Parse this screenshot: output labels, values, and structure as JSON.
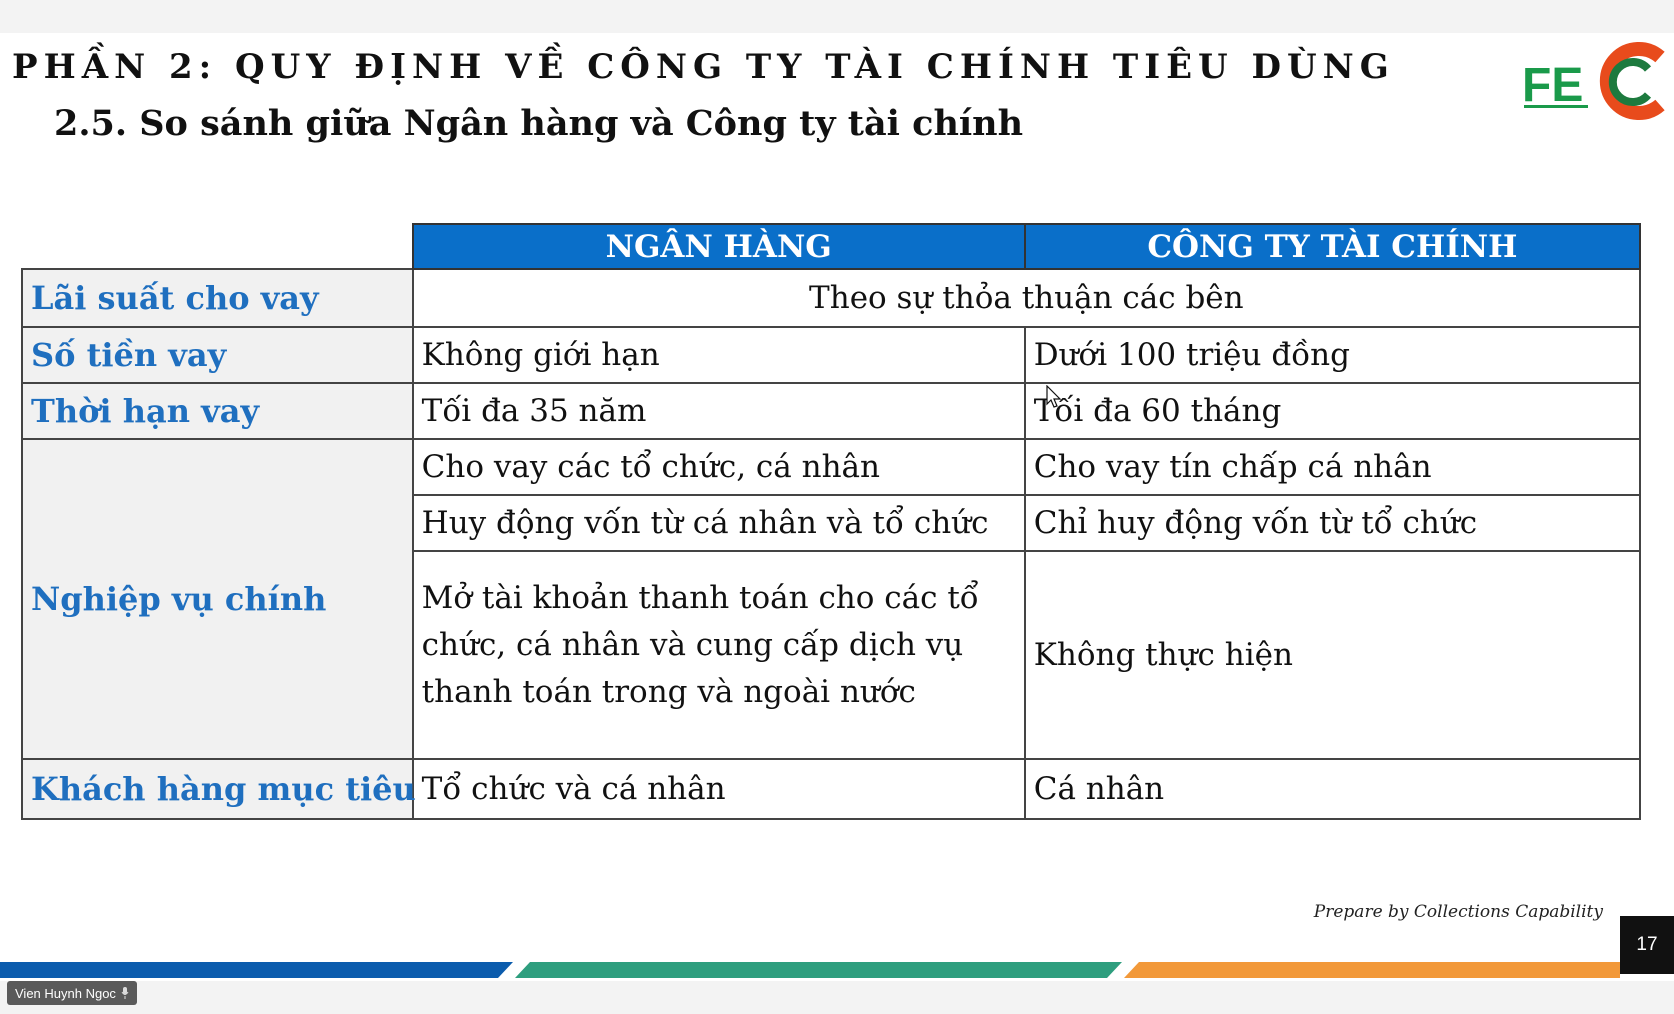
{
  "slide": {
    "heading": "PHẦN 2: QUY ĐỊNH VỀ CÔNG TY TÀI CHÍNH TIÊU DÙNG",
    "subheading": "2.5. So sánh giữa Ngân hàng và Công ty tài chính",
    "logo": {
      "text": "FE",
      "icon": "fec-logo-icon",
      "colors": [
        "#1a9a4a",
        "#e84b1c",
        "#1d7a3e"
      ]
    }
  },
  "table": {
    "columns": [
      "NGÂN HÀNG",
      "CÔNG TY TÀI CHÍNH"
    ],
    "rows": [
      {
        "label": "Lãi suất cho vay",
        "merged": "Theo sự thỏa thuận các bên"
      },
      {
        "label": "Số tiền vay",
        "bank": "Không giới hạn",
        "finance": "Dưới 100 triệu đồng"
      },
      {
        "label": "Thời hạn vay",
        "bank": "Tối đa 35 năm",
        "finance": "Tối đa 60 tháng"
      },
      {
        "label": "Nghiệp vụ chính",
        "sub": [
          {
            "bank": "Cho vay các tổ chức, cá nhân",
            "finance": "Cho vay tín chấp cá nhân"
          },
          {
            "bank": "Huy động vốn từ cá nhân và tổ chức",
            "finance": "Chỉ huy động vốn từ tổ chức"
          },
          {
            "bank_lines": [
              "Mở tài khoản thanh toán cho các tổ",
              "chức, cá nhân và cung cấp dịch vụ",
              "thanh toán trong và ngoài nước"
            ],
            "finance": "Không thực hiện"
          }
        ]
      },
      {
        "label": "Khách hàng mục tiêu",
        "bank": "Tổ chức và cá nhân",
        "finance": "Cá nhân"
      }
    ],
    "colors": {
      "header_bg": "#0a6fc9",
      "label_text": "#1f6fbf"
    }
  },
  "footer": {
    "prepared_by": "Prepare by Collections Capability",
    "page_number": "17",
    "bar_colors": [
      "#0b5cad",
      "#2e9e7e",
      "#f2993a"
    ]
  },
  "meeting": {
    "participant_name": "Vien Huynh Ngoc",
    "mic_icon": "mic-icon"
  }
}
